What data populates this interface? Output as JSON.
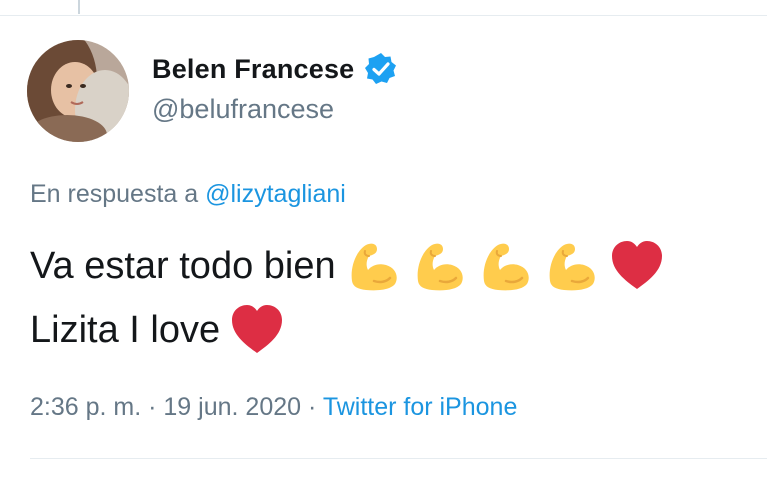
{
  "user": {
    "display_name": "Belen Francese",
    "handle": "@belufrancese",
    "verified_icon": "verified-badge-icon",
    "avatar": "profile-avatar"
  },
  "reply": {
    "prefix": "En respuesta a",
    "mention": "@lizytagliani"
  },
  "tweet": {
    "line1_text": "Va estar todo bien",
    "line1_emojis": [
      "flexed-biceps-emoji",
      "flexed-biceps-emoji",
      "flexed-biceps-emoji",
      "flexed-biceps-emoji",
      "red-heart-emoji"
    ],
    "line2_text": "Lizita I love",
    "line2_emojis": [
      "red-heart-emoji"
    ]
  },
  "meta": {
    "time": "2:36 p. m.",
    "separator": "·",
    "date": "19 jun. 2020",
    "source": "Twitter for iPhone"
  },
  "colors": {
    "link_blue": "#1b95e0",
    "secondary_gray": "#657786",
    "divider": "#e6ecf0",
    "heart_red": "#e0245e",
    "biceps_yellow": "#ffcc4d"
  }
}
